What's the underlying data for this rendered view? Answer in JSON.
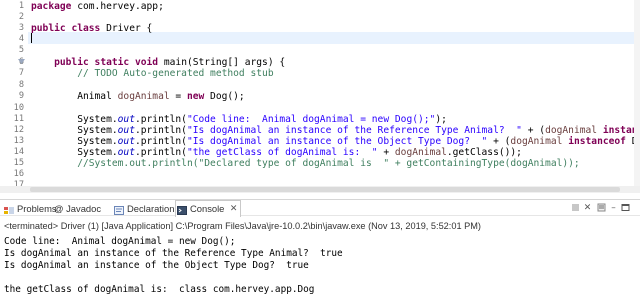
{
  "editor": {
    "lines": [
      {
        "num": "1",
        "code": "package com.hervey.app;"
      },
      {
        "num": "2",
        "code": ""
      },
      {
        "num": "3",
        "code": "public class Driver {"
      },
      {
        "num": "4",
        "code": ""
      },
      {
        "num": "5",
        "code": ""
      },
      {
        "num": "6",
        "code": "    public static void main(String[] args) {"
      },
      {
        "num": "7",
        "code": "        // TODO Auto-generated method stub"
      },
      {
        "num": "8",
        "code": ""
      },
      {
        "num": "9",
        "code": "        Animal dogAnimal = new Dog();"
      },
      {
        "num": "10",
        "code": ""
      },
      {
        "num": "11",
        "code": "        System.out.println(\"Code line:  Animal dogAnimal = new Dog();\");"
      },
      {
        "num": "12",
        "code": "        System.out.println(\"Is dogAnimal an instance of the Reference Type Animal?  \" + (dogAnimal instanceof Animal));"
      },
      {
        "num": "13",
        "code": "        System.out.println(\"Is dogAnimal an instance of the Object Type Dog?  \" + (dogAnimal instanceof Dog) + \"\\n\");"
      },
      {
        "num": "14",
        "code": "        System.out.println(\"the getClass of dogAnimal is:  \" + dogAnimal.getClass());"
      },
      {
        "num": "15",
        "code": "        //System.out.println(\"Declared type of dogAnimal is  \" + getContainingType(dogAnimal));"
      },
      {
        "num": "16",
        "code": ""
      },
      {
        "num": "17",
        "code": ""
      }
    ]
  },
  "views": {
    "tabs": [
      {
        "label": "Problems",
        "icon": "problems-icon"
      },
      {
        "label": "@ Javadoc",
        "icon": "javadoc-icon"
      },
      {
        "label": "Declaration",
        "icon": "declaration-icon"
      },
      {
        "label": "Console",
        "icon": "console-icon",
        "active": true
      }
    ]
  },
  "console": {
    "terminated": "<terminated> Driver (1) [Java Application] C:\\Program Files\\Java\\jre-10.0.2\\bin\\javaw.exe (Nov 13, 2019, 5:52:01 PM)",
    "output": [
      "Code line:  Animal dogAnimal = new Dog();",
      "Is dogAnimal an instance of the Reference Type Animal?  true",
      "Is dogAnimal an instance of the Object Type Dog?  true",
      "",
      "the getClass of dogAnimal is:  class com.hervey.app.Dog"
    ]
  },
  "colors": {
    "keyword": "#7f0055",
    "string": "#2a00ff",
    "comment": "#3f7f5f",
    "current_line": "#e8f2fe"
  }
}
